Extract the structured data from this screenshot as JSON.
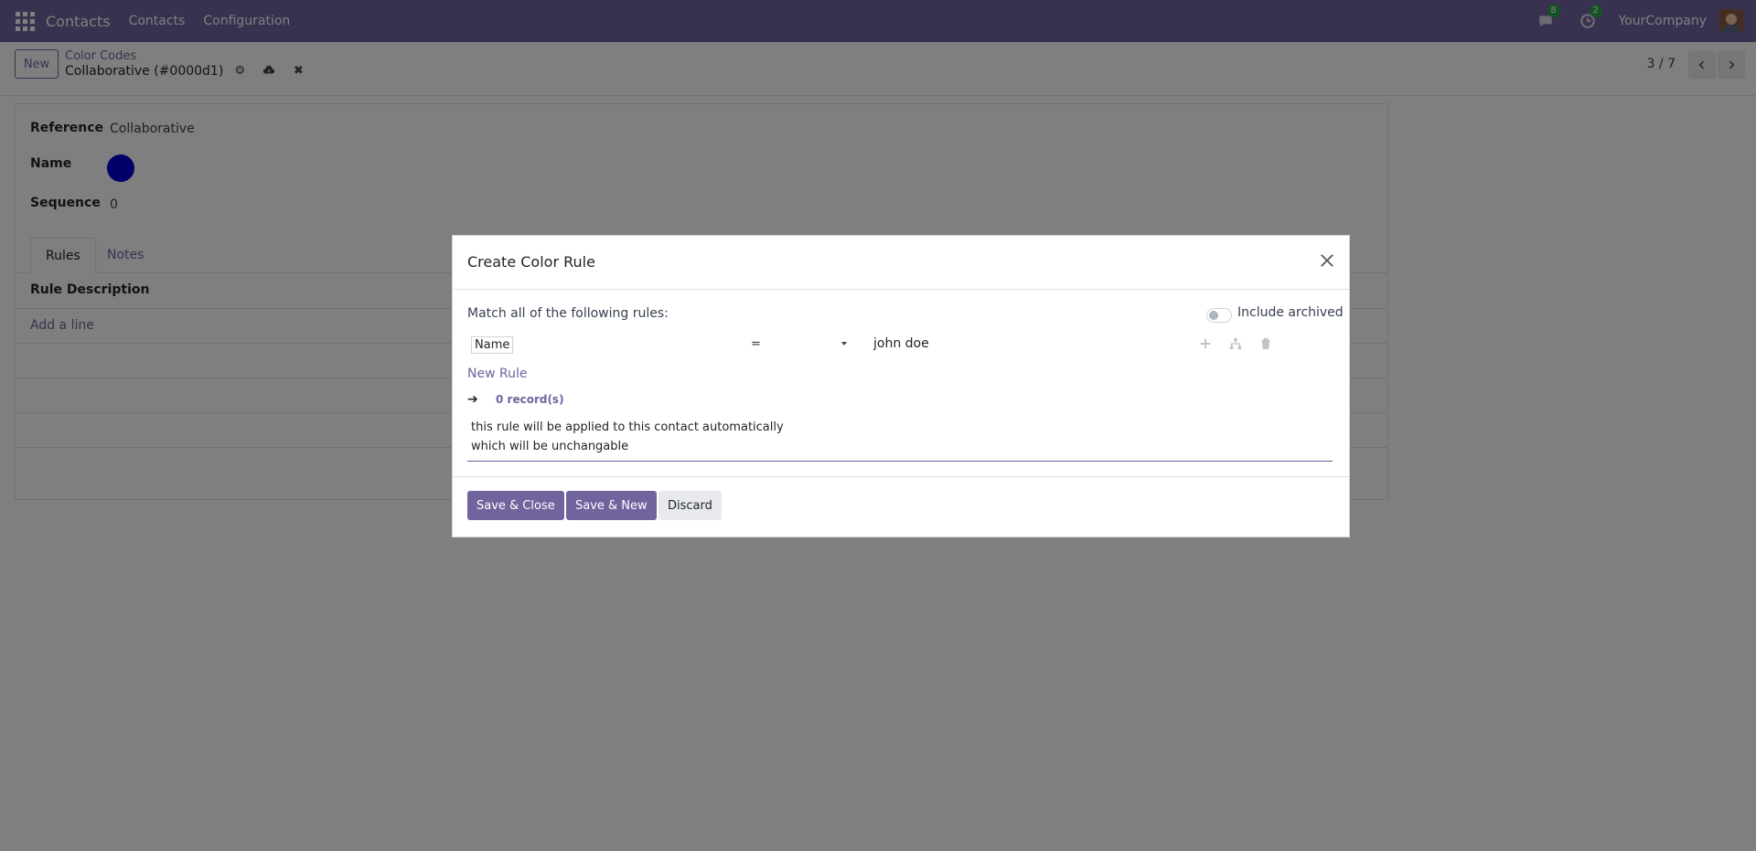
{
  "navbar": {
    "brand": "Contacts",
    "menu": [
      "Contacts",
      "Configuration"
    ],
    "messages_count": "8",
    "activities_count": "2",
    "company": "YourCompany"
  },
  "control_panel": {
    "new_button": "New",
    "breadcrumb_parent": "Color Codes",
    "breadcrumb_current": "Collaborative (#0000d1)",
    "pager": "3 / 7"
  },
  "form": {
    "reference_label": "Reference",
    "reference_value": "Collaborative",
    "name_label": "Name",
    "color": "#0000d1",
    "sequence_label": "Sequence",
    "sequence_value": "0",
    "tabs": [
      "Rules",
      "Notes"
    ],
    "column_header": "Rule Description",
    "add_line": "Add a line"
  },
  "modal": {
    "title": "Create Color Rule",
    "match_text": "Match all of the following rules:",
    "include_archived": "Include archived",
    "rule": {
      "field": "Name",
      "operator": "=",
      "value": "john doe"
    },
    "new_rule": "New Rule",
    "records_arrow": "➔",
    "records_count": "0 record(s)",
    "description_lines": [
      "this rule will be applied to this contact automatically",
      "which will be unchangable"
    ],
    "buttons": {
      "save_close": "Save & Close",
      "save_new": "Save & New",
      "discard": "Discard"
    }
  },
  "colors": {
    "brand": "#71639e",
    "swatch": "#0000d1"
  }
}
